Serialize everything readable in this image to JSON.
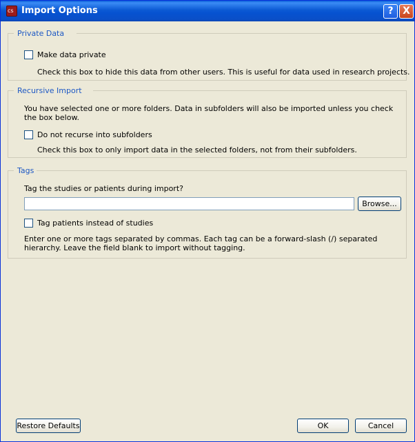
{
  "window": {
    "title": "Import Options",
    "help_label": "?",
    "close_label": "X"
  },
  "private": {
    "title": "Private Data",
    "checkbox_label": "Make data private",
    "checked": false,
    "help": "Check this box to hide this data from other users. This is useful for data used in research projects."
  },
  "recursive": {
    "title": "Recursive Import",
    "description": "You have selected one or more folders. Data in subfolders will also be imported unless you check the box below.",
    "checkbox_label": "Do not recurse into subfolders",
    "checked": false,
    "help": "Check this box to only import data in the selected folders, not from their subfolders."
  },
  "tags": {
    "title": "Tags",
    "prompt": "Tag the studies or patients during import?",
    "value": "",
    "browse_label": "Browse...",
    "checkbox_label": "Tag patients instead of studies",
    "checked": false,
    "help": "Enter one or more tags separated by commas. Each tag can be a forward-slash (/) separated hierarchy. Leave the field blank to import without tagging."
  },
  "footer": {
    "restore_label": "Restore Defaults",
    "ok_label": "OK",
    "cancel_label": "Cancel"
  }
}
